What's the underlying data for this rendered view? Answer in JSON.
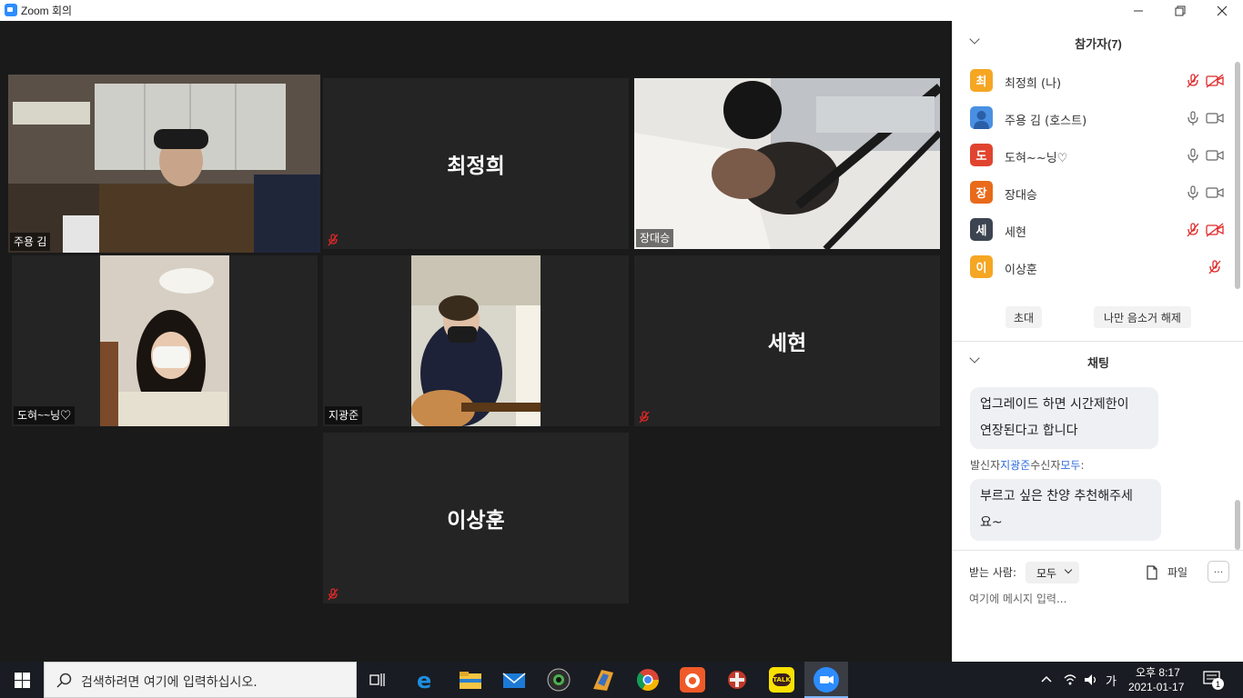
{
  "window": {
    "title": "Zoom 회의",
    "minimize_icon": "minimize-icon",
    "restore_icon": "restore-icon",
    "close_icon": "close-icon"
  },
  "tiles": [
    {
      "name": "주용 김",
      "video": true,
      "active_speaker": true
    },
    {
      "name": "최정희",
      "video": false,
      "muted": true
    },
    {
      "name": "장대승",
      "video": true
    },
    {
      "name": "도혀~~닝♡",
      "video": true
    },
    {
      "name": "지광준",
      "video": true
    },
    {
      "name": "세현",
      "video": false,
      "muted": true
    },
    {
      "name": "이상훈",
      "video": false,
      "muted": true
    }
  ],
  "participants": {
    "title": "참가자(7)",
    "list": [
      {
        "initial": "최",
        "name": "최정희 (나)",
        "color": "#F5A623",
        "mic": "muted",
        "cam": "off"
      },
      {
        "initial": "",
        "name": "주용 김 (호스트)",
        "color": "#4A90E2",
        "mic": "on",
        "cam": "on"
      },
      {
        "initial": "도",
        "name": "도혀~~닝♡",
        "color": "#E0442F",
        "mic": "on",
        "cam": "on"
      },
      {
        "initial": "장",
        "name": "장대승",
        "color": "#E86A1A",
        "mic": "on",
        "cam": "on"
      },
      {
        "initial": "세",
        "name": "세현",
        "color": "#3D4451",
        "mic": "muted",
        "cam": "off"
      },
      {
        "initial": "이",
        "name": "이상훈",
        "color": "#F5A623",
        "mic": "muted",
        "cam": "none"
      }
    ],
    "invite_label": "초대",
    "unmute_me_label": "나만 음소거 해제"
  },
  "chat": {
    "title": "채팅",
    "messages": [
      {
        "text_line1": "업그레이드 하면 시간제한이",
        "text_line2": "연장된다고 합니다"
      },
      {
        "text_line1": "부르고 싶은 찬양 추천해주세",
        "text_line2": "요~"
      }
    ],
    "sender_prefix": "발신자",
    "sender_name": "지광준",
    "receiver_prefix": "수신자",
    "receiver_name": "모두",
    "receiver_suffix": ":",
    "to_label": "받는 사람:",
    "to_value": "모두",
    "file_label": "파일",
    "more_label": "···",
    "input_placeholder": "여기에 메시지 입력..."
  },
  "taskbar": {
    "search_placeholder": "검색하려면 여기에 입력하십시오.",
    "apps": [
      "task-view-icon",
      "edge-icon",
      "file-explorer-icon",
      "mail-icon",
      "camera-app-icon",
      "winamp-icon",
      "chrome-icon",
      "recorder-icon",
      "game-icon",
      "kakaotalk-icon",
      "zoom-icon"
    ],
    "kakao_label": "TALK",
    "ime": "가",
    "time": "오후 8:17",
    "date": "2021-01-17",
    "notification_count": "1"
  },
  "colors": {
    "active_speaker_border": "#d4e457",
    "zoom_blue": "#2D8CFF",
    "muted_red": "#E02828"
  }
}
